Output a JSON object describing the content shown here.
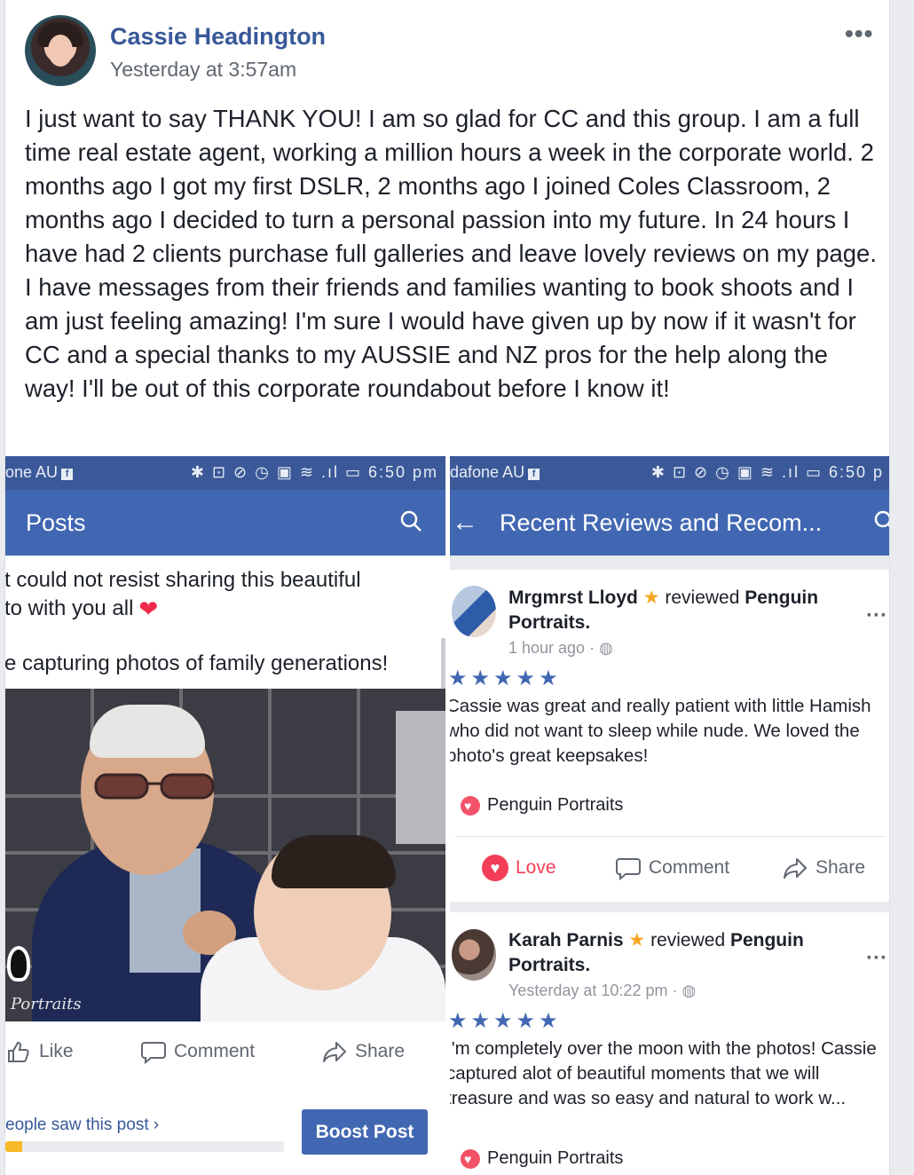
{
  "post": {
    "author": "Cassie Headington",
    "timestamp": "Yesterday at 3:57am",
    "more": "•••",
    "text": "I just want to say THANK YOU! I am so glad for CC and this group. I am a full time real estate agent, working a million hours a week in the corporate world. 2 months ago I got my first DSLR, 2 months ago I joined Coles Classroom, 2 months ago I decided to turn a personal passion into my future. In 24 hours I have had 2 clients purchase full galleries and leave lovely reviews on my page. I have messages from their friends and families wanting to book shoots and I am just feeling amazing! I'm sure I would have given up by now if it wasn't for CC and a special thanks to my AUSSIE and NZ pros for the help along the way! I'll be out of this corporate roundabout before I know it!"
  },
  "left_screen": {
    "carrier": "one AU",
    "fb_badge": "f",
    "status_icons": "✱ ⊡ ⊘ ◷ ▣ ≋ .ıl ▭ 6:50 pm",
    "title": "Posts",
    "post_line1": "t could not resist sharing this beautiful",
    "post_line2": "to with you all",
    "post_line3": "e capturing photos of family generations!",
    "watermark": "Portraits",
    "like": "Like",
    "comment": "Comment",
    "share": "Share",
    "saw_post": "eople saw this post ›",
    "progress": 0.06,
    "boost": "Boost Post"
  },
  "right_screen": {
    "carrier": "dafone AU",
    "fb_badge": "f",
    "status_icons": "✱ ⊡ ⊘ ◷ ▣ ≋ .ıl ▭ 6:50 p",
    "title": "Recent Reviews and Recom...",
    "reviews": [
      {
        "name": "Mrgmrst Lloyd",
        "verb": "reviewed",
        "page": "Penguin",
        "page2": "Portraits.",
        "time": "1 hour ago ·",
        "stars": "★★★★★",
        "text": "Cassie was great and really patient with little Hamish who did not want to sleep while nude. We loved the photo's great keepsakes!",
        "tag": "Penguin Portraits",
        "love": "Love",
        "comment": "Comment",
        "share": "Share"
      },
      {
        "name": "Karah Parnis",
        "verb": "reviewed",
        "page": "Penguin",
        "page2": "Portraits.",
        "time": "Yesterday at 10:22 pm ·",
        "stars": "★★★★★",
        "text": "I'm completely over the moon with the photos! Cassie captured alot of beautiful moments that we will treasure and was so easy and natural to work w...",
        "tag": "Penguin Portraits"
      }
    ]
  },
  "colors": {
    "fb_blue": "#4267b2",
    "status_blue": "#3b5998",
    "link_blue": "#385898",
    "love_red": "#f33e58",
    "progress_yellow": "#f7b928"
  }
}
